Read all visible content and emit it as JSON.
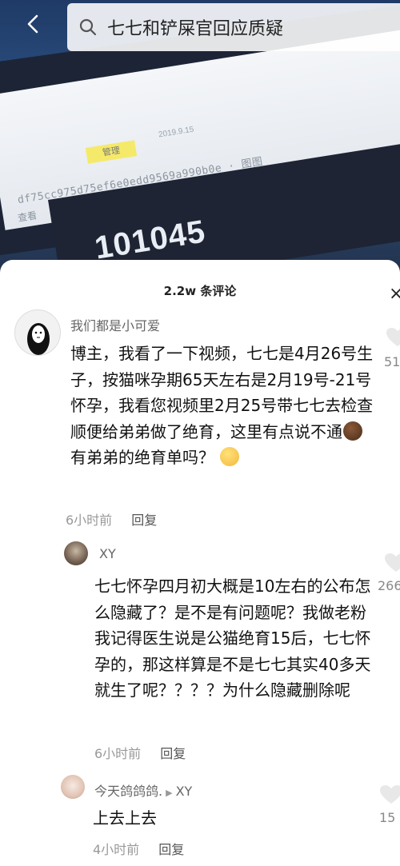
{
  "header": {
    "search_query": "七七和铲屎官回应质疑"
  },
  "video": {
    "tag": "管理",
    "date": "2019.9.15",
    "hash": "df75cc975d75ef6e0edd9569a990b0e",
    "hash_suffix": "· 图图",
    "view_link": "查看",
    "number": "101045"
  },
  "comments_panel": {
    "title": "2.2w 条评论",
    "close": "×"
  },
  "comments": [
    {
      "username": "我们都是小可爱",
      "text_before_emoji": "博主，我看了一下视频，七七是4月26号生子，按猫咪孕期65天左右是2月19号-21号怀孕，我看您视频里2月25号带七七去检查顺便给弟弟做了绝育，这里有点说不通",
      "text_after_emoji": "有弟弟的绝育单吗？",
      "time": "6小时前",
      "reply_label": "回复",
      "likes": "51"
    },
    {
      "username": "XY",
      "text": "七七怀孕四月初大概是10左右的公布怎么隐藏了？是不是有问题呢？我做老粉我记得医生说是公猫绝育15后，七七怀孕的，那这样算是不是七七其实40多天就生了呢？？？？为什么隐藏删除呢",
      "time": "6小时前",
      "reply_label": "回复",
      "likes": "266"
    },
    {
      "username": "今天鸽鸽鸽.",
      "reply_to": "XY",
      "text": "上去上去",
      "time": "4小时前",
      "reply_label": "回复",
      "likes": "15"
    }
  ],
  "colors": {
    "sheet_bg": "#ffffff",
    "text_primary": "#111111",
    "text_secondary": "#999999",
    "highlight_tag": "#f5e96a"
  }
}
